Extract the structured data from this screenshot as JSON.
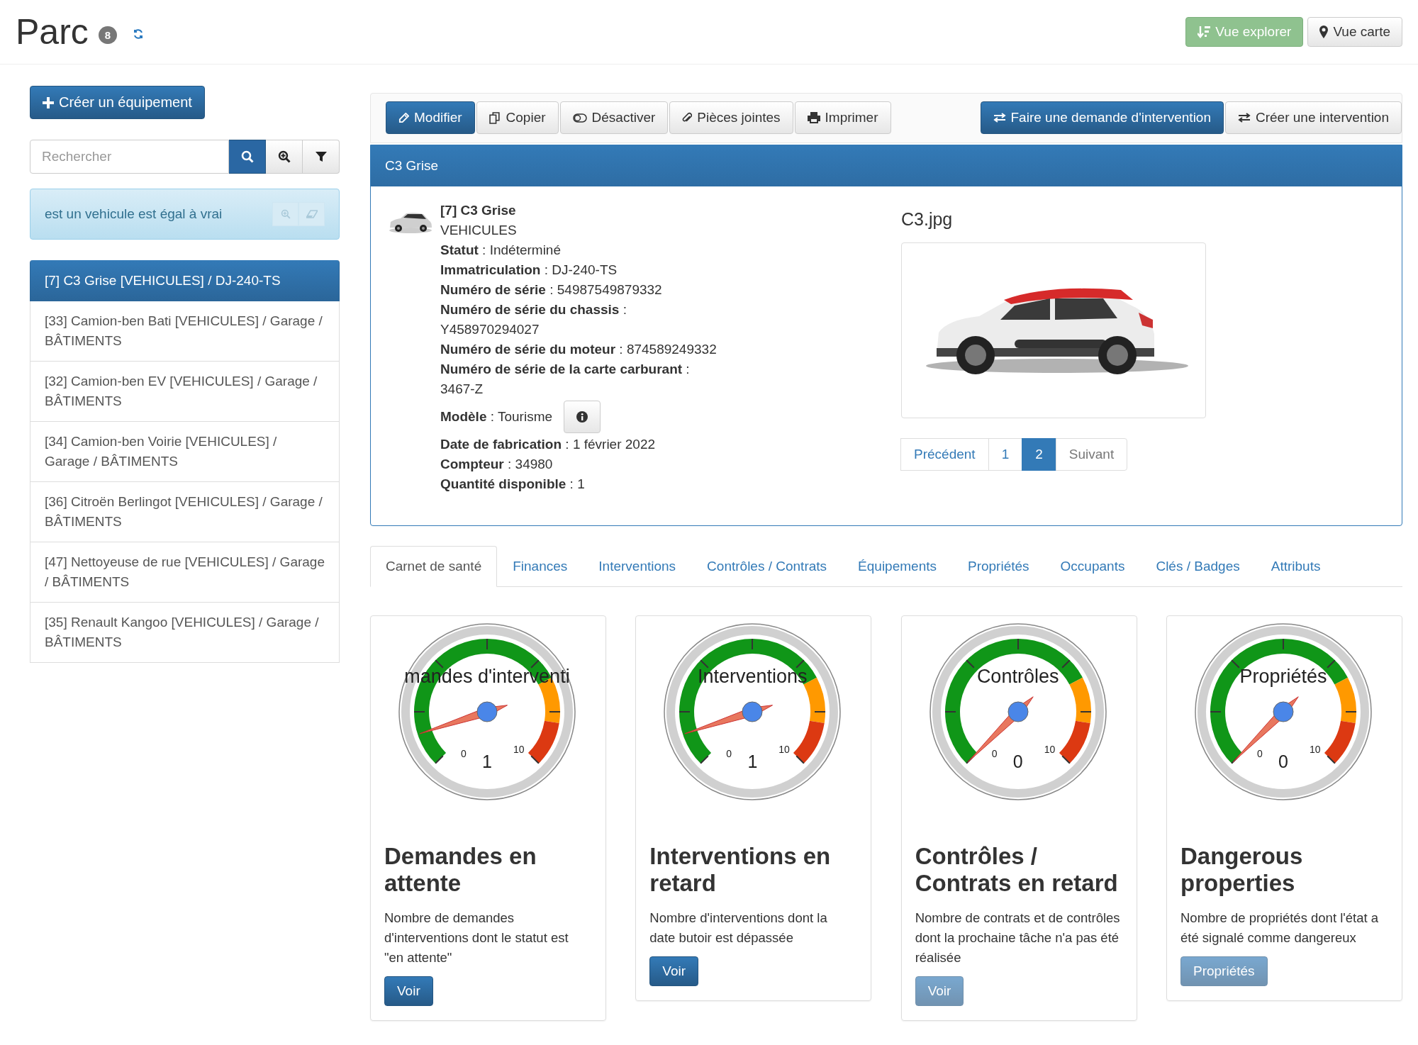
{
  "header": {
    "title": "Parc",
    "count": "8"
  },
  "view_buttons": [
    {
      "label": "Vue explorer",
      "selected": true
    },
    {
      "label": "Vue carte",
      "selected": false
    }
  ],
  "create_button": "Créer un équipement",
  "search": {
    "placeholder": "Rechercher"
  },
  "filter": {
    "text": "est un vehicule est égal à vrai"
  },
  "list": [
    {
      "label": "[7] C3 Grise [VEHICULES] / DJ-240-TS",
      "selected": true
    },
    {
      "label": "[33] Camion-ben Bati [VEHICULES] / Garage / BÂTIMENTS",
      "selected": false
    },
    {
      "label": "[32] Camion-ben EV [VEHICULES] / Garage / BÂTIMENTS",
      "selected": false
    },
    {
      "label": "[34] Camion-ben Voirie [VEHICULES] / Garage / BÂTIMENTS",
      "selected": false
    },
    {
      "label": "[36] Citroën Berlingot [VEHICULES] / Garage / BÂTIMENTS",
      "selected": false
    },
    {
      "label": "[47] Nettoyeuse de rue [VEHICULES] / Garage / BÂTIMENTS",
      "selected": false
    },
    {
      "label": "[35] Renault Kangoo [VEHICULES] / Garage / BÂTIMENTS",
      "selected": false
    }
  ],
  "toolbar": {
    "left": [
      {
        "label": "Modifier",
        "kind": "primary"
      },
      {
        "label": "Copier",
        "kind": "default"
      },
      {
        "label": "Désactiver",
        "kind": "default"
      },
      {
        "label": "Pièces jointes",
        "kind": "default"
      },
      {
        "label": "Imprimer",
        "kind": "default"
      }
    ],
    "right": [
      {
        "label": "Faire une demande d'intervention",
        "kind": "primary"
      },
      {
        "label": "Créer une intervention",
        "kind": "default"
      }
    ]
  },
  "panel": {
    "title": "C3 Grise",
    "name": "[7] C3 Grise",
    "category": "VEHICULES",
    "fields": [
      {
        "label": "Statut",
        "value": ": Indéterminé",
        "kind": "text"
      },
      {
        "label": "Immatriculation",
        "value": ": DJ-240-TS",
        "kind": "text"
      },
      {
        "label": "Numéro de série",
        "value": ": 54987549879332",
        "kind": "text"
      },
      {
        "label": "Numéro de série du chassis",
        "value": ": Y458970294027",
        "kind": "text"
      },
      {
        "label": "Numéro de série du moteur",
        "value": ": 874589249332",
        "kind": "text"
      },
      {
        "label": "Numéro de série de la carte carburant",
        "value": ": 3467-Z",
        "kind": "text"
      },
      {
        "label": "Modèle",
        "value": ": Tourisme",
        "kind": "info"
      },
      {
        "label": "Date de fabrication",
        "value": ": 1 février 2022",
        "kind": "text"
      },
      {
        "label": "Compteur",
        "value": ": 34980",
        "kind": "text"
      },
      {
        "label": "Quantité disponible",
        "value": ": 1",
        "kind": "text"
      }
    ],
    "image": {
      "filename": "C3.jpg",
      "kind": "picture"
    },
    "pagination": {
      "previous": "Précédent",
      "next": "Suivant",
      "pages": [
        {
          "label": "1",
          "selected": false
        },
        {
          "label": "2",
          "selected": true
        }
      ]
    }
  },
  "tabs": [
    {
      "label": "Carnet de santé",
      "selected": true
    },
    {
      "label": "Finances",
      "selected": false
    },
    {
      "label": "Interventions",
      "selected": false
    },
    {
      "label": "Contrôles / Contrats",
      "selected": false
    },
    {
      "label": "Équipements",
      "selected": false
    },
    {
      "label": "Propriétés",
      "selected": false
    },
    {
      "label": "Occupants",
      "selected": false
    },
    {
      "label": "Clés / Badges",
      "selected": false
    },
    {
      "label": "Attributs",
      "selected": false
    }
  ],
  "cards": [
    {
      "gauge_title": "mandes d'interventi",
      "value": "1",
      "min": "0",
      "max": "10",
      "heading": "Demandes en attente",
      "description": "Nombre de demandes d'interventions dont le statut est \"en attente\"",
      "button": {
        "label": "Voir",
        "disabled": false
      }
    },
    {
      "gauge_title": "Interventions",
      "value": "1",
      "min": "0",
      "max": "10",
      "heading": "Interventions en retard",
      "description": "Nombre d'interventions dont la date butoir est dépassée",
      "button": {
        "label": "Voir",
        "disabled": false
      }
    },
    {
      "gauge_title": "Contrôles",
      "value": "0",
      "min": "0",
      "max": "10",
      "heading": "Contrôles / Contrats en retard",
      "description": "Nombre de contrats et de contrôles dont la prochaine tâche n'a pas été réalisée",
      "button": {
        "label": "Voir",
        "disabled": true
      }
    },
    {
      "gauge_title": "Propriétés",
      "value": "0",
      "min": "0",
      "max": "10",
      "heading": "Dangerous properties",
      "description": "Nombre de propriétés dont l'état a été signalé comme dangereux",
      "button": {
        "label": "Propriétés",
        "disabled": true
      }
    }
  ]
}
